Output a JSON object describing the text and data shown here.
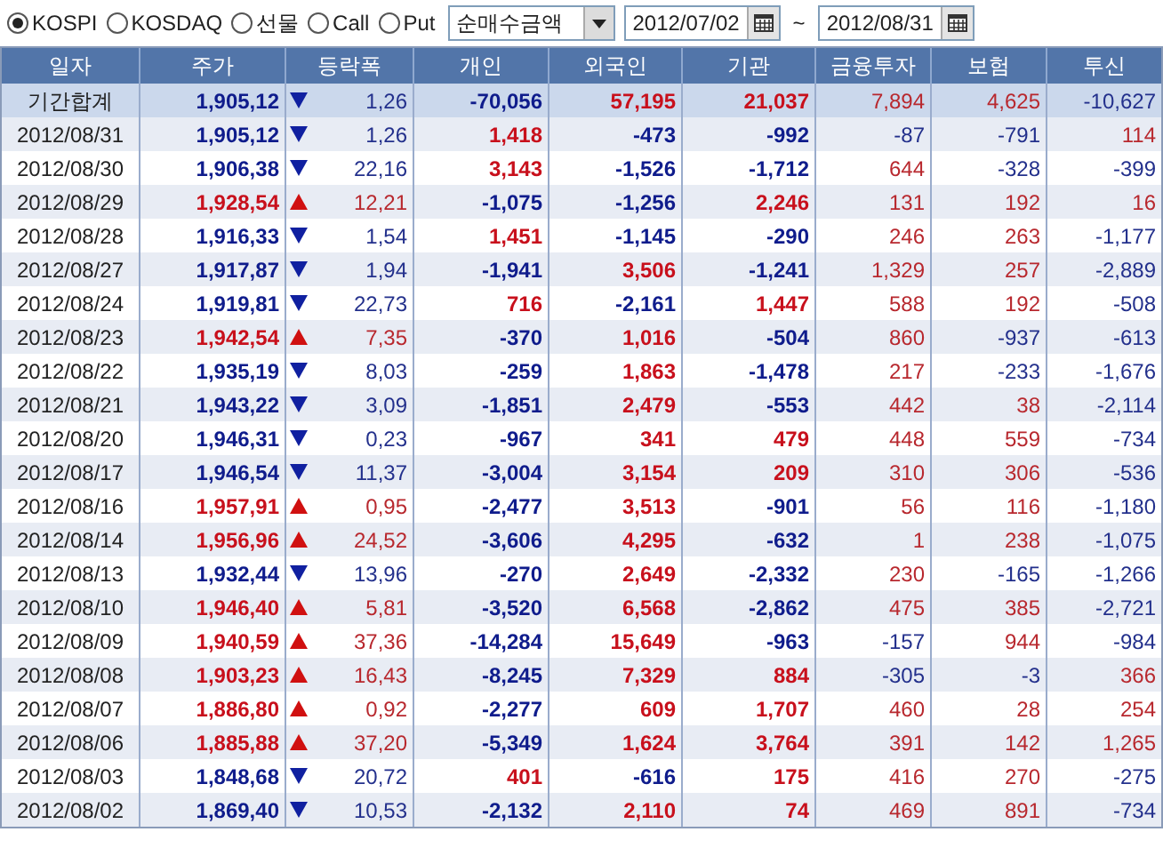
{
  "toolbar": {
    "markets": [
      {
        "label": "KOSPI",
        "selected": true
      },
      {
        "label": "KOSDAQ",
        "selected": false
      },
      {
        "label": "선물",
        "selected": false
      },
      {
        "label": "Call",
        "selected": false
      },
      {
        "label": "Put",
        "selected": false
      }
    ],
    "metric": {
      "value": "순매수금액"
    },
    "date_from": {
      "value": "2012/07/02"
    },
    "separator": "~",
    "date_to": {
      "value": "2012/08/31"
    }
  },
  "table": {
    "columns": [
      "일자",
      "주가",
      "등락폭",
      "개인",
      "외국인",
      "기관",
      "금융투자",
      "보험",
      "투신"
    ],
    "rows": [
      {
        "kind": "total",
        "date": "기간합계",
        "price": "1,905,12",
        "rising": false,
        "change": "1,26",
        "cells": [
          "-70,056",
          "57,195",
          "21,037",
          "7,894",
          "4,625",
          "-10,627"
        ]
      },
      {
        "kind": "day",
        "date": "2012/08/31",
        "price": "1,905,12",
        "rising": false,
        "change": "1,26",
        "cells": [
          "1,418",
          "-473",
          "-992",
          "-87",
          "-791",
          "114"
        ]
      },
      {
        "kind": "day",
        "date": "2012/08/30",
        "price": "1,906,38",
        "rising": false,
        "change": "22,16",
        "cells": [
          "3,143",
          "-1,526",
          "-1,712",
          "644",
          "-328",
          "-399"
        ]
      },
      {
        "kind": "day",
        "date": "2012/08/29",
        "price": "1,928,54",
        "rising": true,
        "change": "12,21",
        "cells": [
          "-1,075",
          "-1,256",
          "2,246",
          "131",
          "192",
          "16"
        ]
      },
      {
        "kind": "day",
        "date": "2012/08/28",
        "price": "1,916,33",
        "rising": false,
        "change": "1,54",
        "cells": [
          "1,451",
          "-1,145",
          "-290",
          "246",
          "263",
          "-1,177"
        ]
      },
      {
        "kind": "day",
        "date": "2012/08/27",
        "price": "1,917,87",
        "rising": false,
        "change": "1,94",
        "cells": [
          "-1,941",
          "3,506",
          "-1,241",
          "1,329",
          "257",
          "-2,889"
        ]
      },
      {
        "kind": "day",
        "date": "2012/08/24",
        "price": "1,919,81",
        "rising": false,
        "change": "22,73",
        "cells": [
          "716",
          "-2,161",
          "1,447",
          "588",
          "192",
          "-508"
        ]
      },
      {
        "kind": "day",
        "date": "2012/08/23",
        "price": "1,942,54",
        "rising": true,
        "change": "7,35",
        "cells": [
          "-370",
          "1,016",
          "-504",
          "860",
          "-937",
          "-613"
        ]
      },
      {
        "kind": "day",
        "date": "2012/08/22",
        "price": "1,935,19",
        "rising": false,
        "change": "8,03",
        "cells": [
          "-259",
          "1,863",
          "-1,478",
          "217",
          "-233",
          "-1,676"
        ]
      },
      {
        "kind": "day",
        "date": "2012/08/21",
        "price": "1,943,22",
        "rising": false,
        "change": "3,09",
        "cells": [
          "-1,851",
          "2,479",
          "-553",
          "442",
          "38",
          "-2,114"
        ]
      },
      {
        "kind": "day",
        "date": "2012/08/20",
        "price": "1,946,31",
        "rising": false,
        "change": "0,23",
        "cells": [
          "-967",
          "341",
          "479",
          "448",
          "559",
          "-734"
        ]
      },
      {
        "kind": "day",
        "date": "2012/08/17",
        "price": "1,946,54",
        "rising": false,
        "change": "11,37",
        "cells": [
          "-3,004",
          "3,154",
          "209",
          "310",
          "306",
          "-536"
        ]
      },
      {
        "kind": "day",
        "date": "2012/08/16",
        "price": "1,957,91",
        "rising": true,
        "change": "0,95",
        "cells": [
          "-2,477",
          "3,513",
          "-901",
          "56",
          "116",
          "-1,180"
        ]
      },
      {
        "kind": "day",
        "date": "2012/08/14",
        "price": "1,956,96",
        "rising": true,
        "change": "24,52",
        "cells": [
          "-3,606",
          "4,295",
          "-632",
          "1",
          "238",
          "-1,075"
        ]
      },
      {
        "kind": "day",
        "date": "2012/08/13",
        "price": "1,932,44",
        "rising": false,
        "change": "13,96",
        "cells": [
          "-270",
          "2,649",
          "-2,332",
          "230",
          "-165",
          "-1,266"
        ]
      },
      {
        "kind": "day",
        "date": "2012/08/10",
        "price": "1,946,40",
        "rising": true,
        "change": "5,81",
        "cells": [
          "-3,520",
          "6,568",
          "-2,862",
          "475",
          "385",
          "-2,721"
        ]
      },
      {
        "kind": "day",
        "date": "2012/08/09",
        "price": "1,940,59",
        "rising": true,
        "change": "37,36",
        "cells": [
          "-14,284",
          "15,649",
          "-963",
          "-157",
          "944",
          "-984"
        ]
      },
      {
        "kind": "day",
        "date": "2012/08/08",
        "price": "1,903,23",
        "rising": true,
        "change": "16,43",
        "cells": [
          "-8,245",
          "7,329",
          "884",
          "-305",
          "-3",
          "366"
        ]
      },
      {
        "kind": "day",
        "date": "2012/08/07",
        "price": "1,886,80",
        "rising": true,
        "change": "0,92",
        "cells": [
          "-2,277",
          "609",
          "1,707",
          "460",
          "28",
          "254"
        ]
      },
      {
        "kind": "day",
        "date": "2012/08/06",
        "price": "1,885,88",
        "rising": true,
        "change": "37,20",
        "cells": [
          "-5,349",
          "1,624",
          "3,764",
          "391",
          "142",
          "1,265"
        ]
      },
      {
        "kind": "day",
        "date": "2012/08/03",
        "price": "1,848,68",
        "rising": false,
        "change": "20,72",
        "cells": [
          "401",
          "-616",
          "175",
          "416",
          "270",
          "-275"
        ]
      },
      {
        "kind": "day",
        "date": "2012/08/02",
        "price": "1,869,40",
        "rising": false,
        "change": "10,53",
        "cells": [
          "-2,132",
          "2,110",
          "74",
          "469",
          "891",
          "-734"
        ]
      }
    ]
  }
}
